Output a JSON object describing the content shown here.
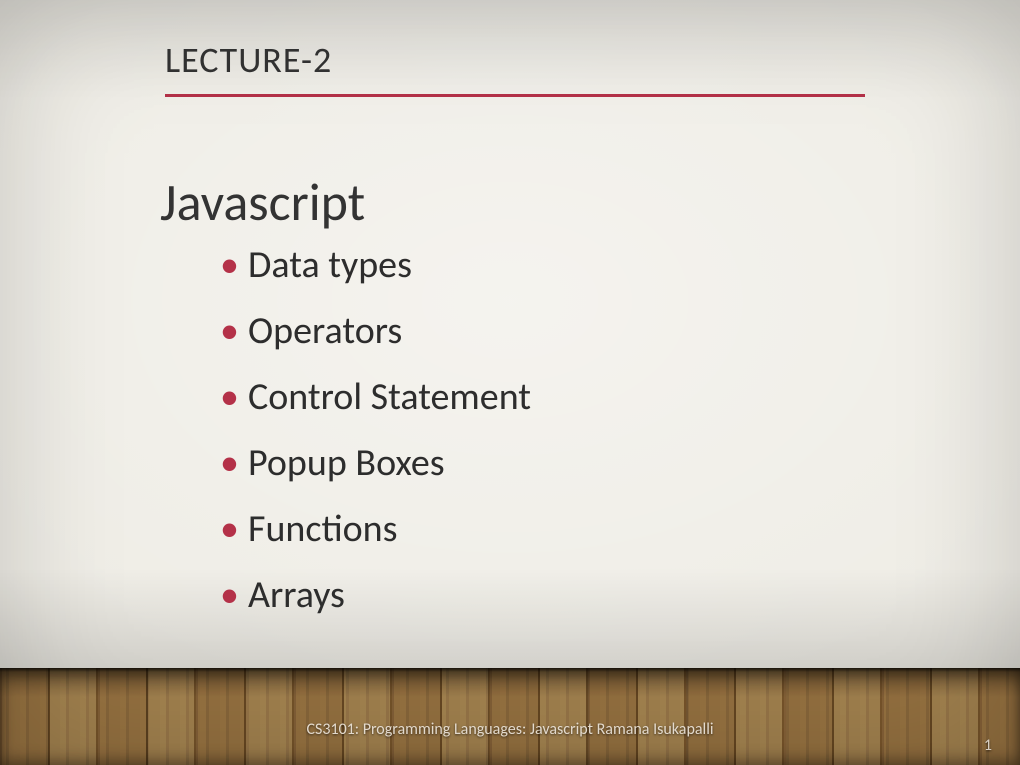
{
  "header": {
    "title": "LECTURE-2"
  },
  "subtitle": "Javascript",
  "bullets": [
    "Data types",
    "Operators",
    "Control Statement",
    "Popup Boxes",
    "Functions",
    "Arrays"
  ],
  "footer": {
    "course_line": "CS3101: Programming Languages: Javascript Ramana Isukapalli",
    "page_number": "1"
  },
  "colors": {
    "accent": "#b43148",
    "wall": "#efede6",
    "text": "#333333"
  }
}
